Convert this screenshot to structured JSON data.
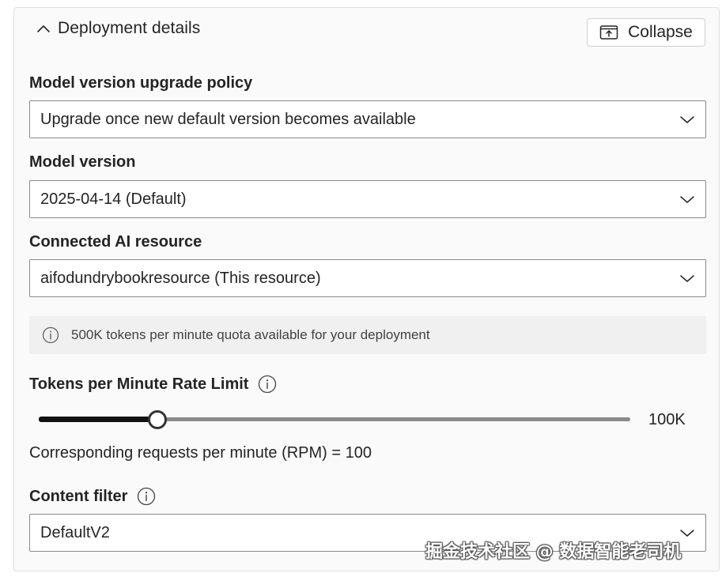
{
  "section": {
    "title": "Deployment details",
    "toggle_icon": "chevron-up-icon"
  },
  "collapse_button": {
    "label": "Collapse",
    "icon": "collapse-icon"
  },
  "model_version_upgrade_policy": {
    "label": "Model version upgrade policy",
    "value": "Upgrade once new default version becomes available"
  },
  "model_version": {
    "label": "Model version",
    "value": "2025-04-14 (Default)"
  },
  "connected_ai_resource": {
    "label": "Connected AI resource",
    "value": "aifodundrybookresource (This resource)"
  },
  "quota_info": {
    "text": "500K tokens per minute quota available for your deployment",
    "icon": "info-icon"
  },
  "rate_limit": {
    "label": "Tokens per Minute Rate Limit",
    "icon": "info-icon",
    "value_label": "100K",
    "fraction": 0.2
  },
  "rpm": {
    "text": "Corresponding requests per minute (RPM) = 100"
  },
  "content_filter": {
    "label": "Content filter",
    "icon": "info-icon",
    "value": "DefaultV2"
  },
  "watermark": {
    "text": "掘金技术社区 @ 数据智能老司机"
  },
  "colors": {
    "panel_background": "#fafafa",
    "info_bar_background": "#f0f0f0",
    "slider_fill": "#111111",
    "slider_rail": "#8a8a8a",
    "text": "#242424"
  }
}
